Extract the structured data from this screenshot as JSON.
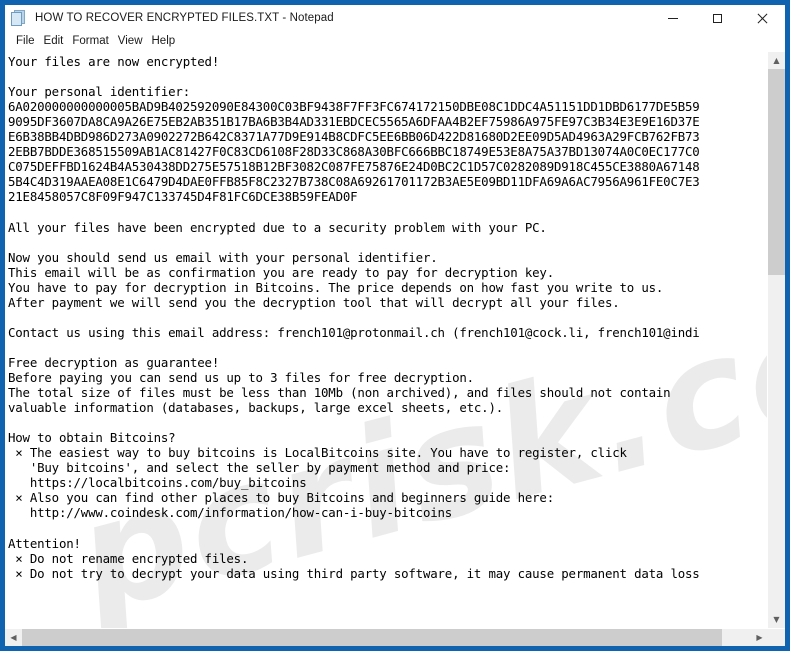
{
  "window": {
    "title": "HOW TO RECOVER ENCRYPTED FILES.TXT - Notepad",
    "icon": "notepad-document-icon",
    "frame_color": "#1063ae",
    "background": "#ffffff",
    "controls": {
      "minimize": "–",
      "maximize": "☐",
      "close": "✕"
    }
  },
  "menubar": {
    "items": [
      {
        "label": "File"
      },
      {
        "label": "Edit"
      },
      {
        "label": "Format"
      },
      {
        "label": "View"
      },
      {
        "label": "Help"
      }
    ]
  },
  "watermark": {
    "text": "pcrisk.com"
  },
  "scrollbars": {
    "vertical": {
      "up_arrow": "▲",
      "down_arrow": "▼",
      "thumb_position": "top"
    },
    "horizontal": {
      "left_arrow": "‹",
      "right_arrow": "›",
      "thumb_position": "left"
    }
  },
  "document": {
    "filename": "HOW TO RECOVER ENCRYPTED FILES.TXT",
    "heading": "Your files are now encrypted!",
    "identifier_label": "Your personal identifier:",
    "identifier_lines": [
      "6A020000000000005BAD9B402592090E84300C03BF9438F7FF3FC674172150DBE08C1DDC4A51151DD1DBD6177DE5B59",
      "9095DF3607DA8CA9A26E75EB2AB351B17BA6B3B4AD331EBDCEC5565A6DFAA4B2EF75986A975FE97C3B34E3E9E16D37E",
      "E6B38BB4DBD986D273A0902272B642C8371A77D9E914B8CDFC5EE6BB06D422D81680D2EE09D5AD4963A29FCB762FB73",
      "2EBB7BDDE368515509AB1AC81427F0C83CD6108F28D33C868A30BFC666BBC18749E53E8A75A37BD13074A0C0EC177C0",
      "C075DEFFBD1624B4A530438DD275E57518B12BF3082C087FE75876E24D0BC2C1D57C0282089D918C455CE3880A67148",
      "5B4C4D319AAEA08E1C6479D4DAE0FFB85F8C2327B738C08A69261701172B3AE5E09BD11DFA69A6AC7956A961FE0C7E3",
      "21E8458057C8F09F947C133745D4F81FC6DCE38B59FEAD0F"
    ],
    "paragraphs": {
      "encrypted_notice": "All your files have been encrypted due to a security problem with your PC.",
      "instructions": [
        "Now you should send us email with your personal identifier.",
        "This email will be as confirmation you are ready to pay for decryption key.",
        "You have to pay for decryption in Bitcoins. The price depends on how fast you write to us.",
        "After payment we will send you the decryption tool that will decrypt all your files."
      ],
      "contact_line": "Contact us using this email address: french101@protonmail.ch (french101@cock.li, french101@indi",
      "free_decryption_heading": "Free decryption as guarantee!",
      "free_decryption_lines": [
        "Before paying you can send us up to 3 files for free decryption.",
        "The total size of files must be less than 10Mb (non archived), and files should not contain",
        "valuable information (databases, backups, large excel sheets, etc.)."
      ],
      "bitcoins_heading": "How to obtain Bitcoins?",
      "bitcoins_bullets": [
        " × The easiest way to buy bitcoins is LocalBitcoins site. You have to register, click",
        "   'Buy bitcoins', and select the seller by payment method and price:",
        "   https://localbitcoins.com/buy_bitcoins",
        " × Also you can find other places to buy Bitcoins and beginners guide here:",
        "   http://www.coindesk.com/information/how-can-i-buy-bitcoins"
      ],
      "attention_heading": "Attention!",
      "attention_bullets": [
        " × Do not rename encrypted files.",
        " × Do not try to decrypt your data using third party software, it may cause permanent data loss"
      ]
    },
    "emails": [
      "french101@protonmail.ch",
      "french101@cock.li",
      "french101@indi"
    ],
    "links": [
      "https://localbitcoins.com/buy_bitcoins",
      "http://www.coindesk.com/information/how-can-i-buy-bitcoins"
    ]
  }
}
